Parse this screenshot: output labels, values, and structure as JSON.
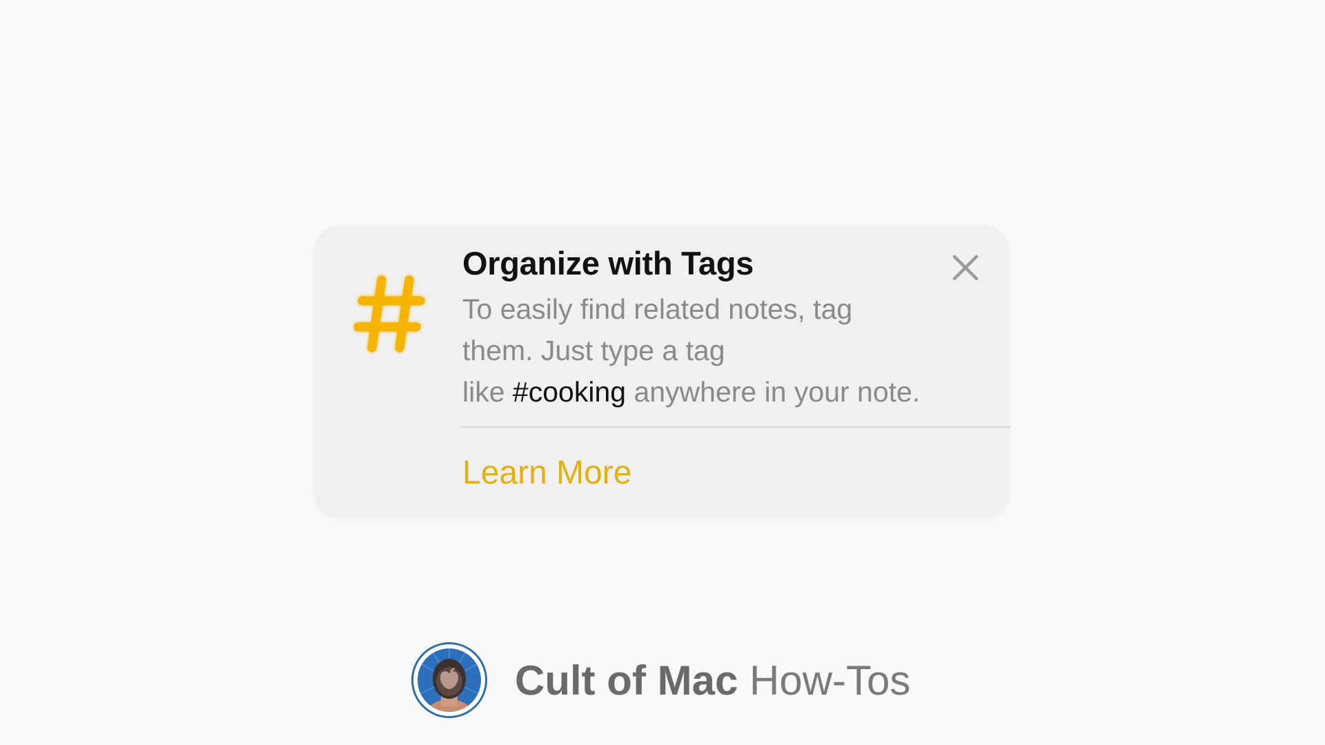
{
  "tip": {
    "title": "Organize with Tags",
    "body_line1": "To easily find related notes, tag",
    "body_line2": "them. Just type a tag",
    "body_line3_before": "like ",
    "body_tag_example": "#cooking",
    "body_line3_after": " anywhere in your note.",
    "learn_more_label": "Learn More",
    "icon": "hashtag-icon",
    "close_icon": "close-icon"
  },
  "brand": {
    "name_bold": "Cult of Mac",
    "name_light": "How-Tos",
    "avatar_icon": "avatar"
  },
  "colors": {
    "accent": "#E2B010",
    "hash_icon": "#F5B400",
    "background": "#F9F9F9",
    "card": "#F0F0F0",
    "body_text": "#8A8A8A",
    "avatar_ring": "#2F6FA8"
  }
}
